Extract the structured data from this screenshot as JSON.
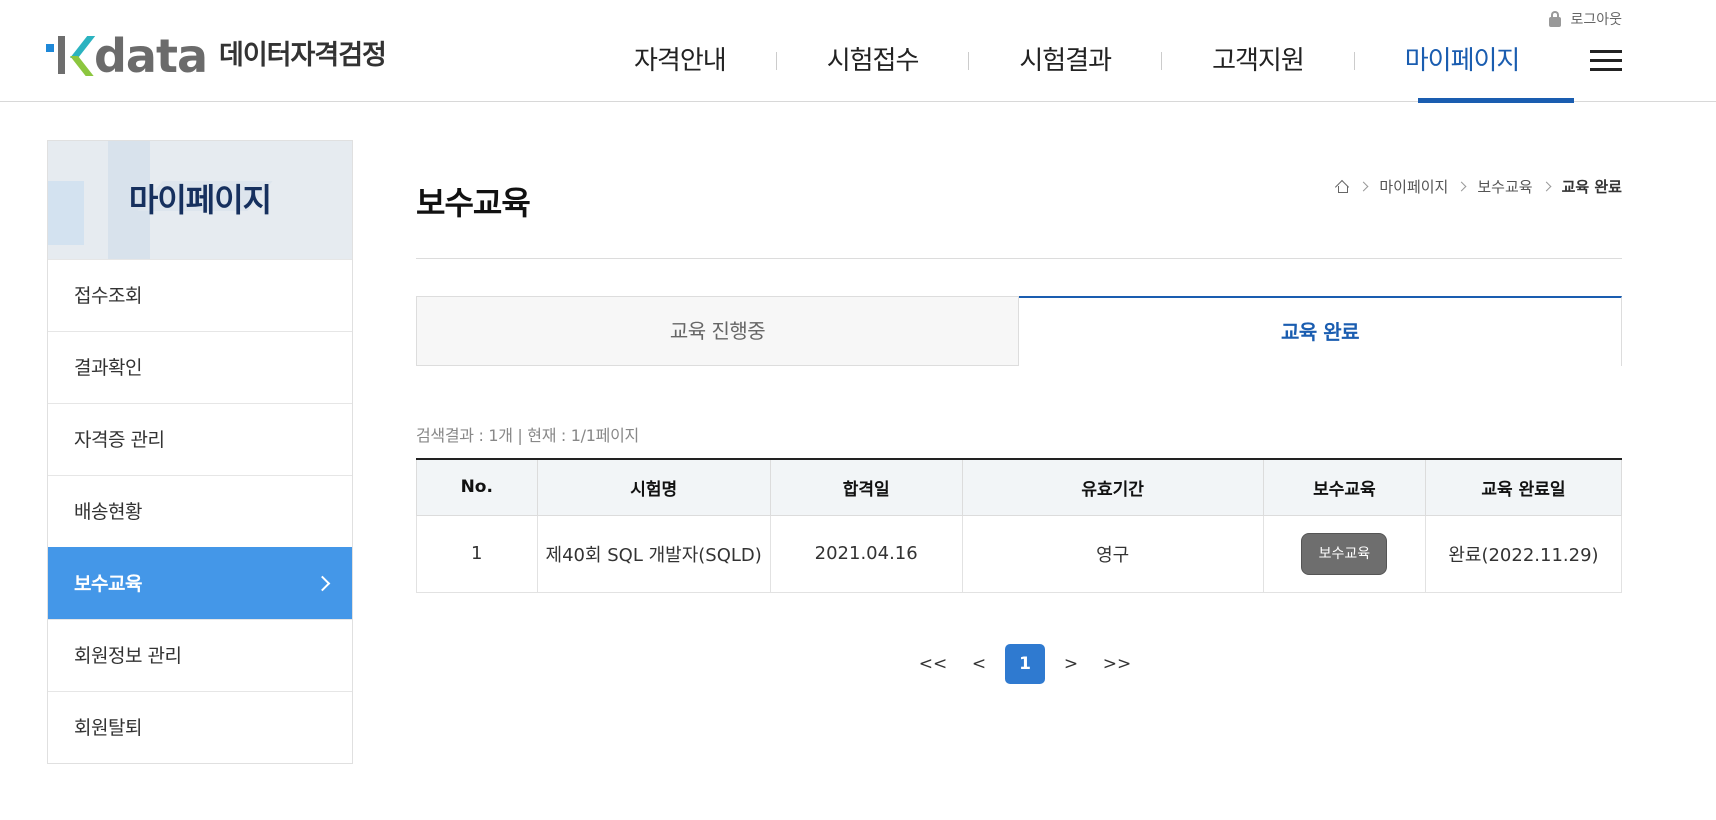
{
  "header": {
    "logo_word": "data",
    "logo_sub": "데이터자격검정",
    "logout_label": "로그아웃",
    "nav": [
      {
        "label": "자격안내"
      },
      {
        "label": "시험접수"
      },
      {
        "label": "시험결과"
      },
      {
        "label": "고객지원"
      },
      {
        "label": "마이페이지",
        "active": true
      }
    ]
  },
  "sidebar": {
    "title": "마이페이지",
    "items": [
      {
        "label": "접수조회"
      },
      {
        "label": "결과확인"
      },
      {
        "label": "자격증 관리"
      },
      {
        "label": "배송현황"
      },
      {
        "label": "보수교육",
        "active": true
      },
      {
        "label": "회원정보 관리"
      },
      {
        "label": "회원탈퇴"
      }
    ]
  },
  "main": {
    "title": "보수교육",
    "breadcrumb": [
      "마이페이지",
      "보수교육",
      "교육 완료"
    ],
    "tabs": [
      {
        "label": "교육 진행중"
      },
      {
        "label": "교육 완료",
        "active": true
      }
    ],
    "result_info": "검색결과 : 1개 | 현재 : 1/1페이지",
    "table": {
      "headers": [
        "No.",
        "시험명",
        "합격일",
        "유효기간",
        "보수교육",
        "교육 완료일"
      ],
      "rows": [
        {
          "no": "1",
          "exam": "제40회 SQL 개발자(SQLD)",
          "pass_date": "2021.04.16",
          "validity": "영구",
          "button": "보수교육",
          "completed": "완료(2022.11.29)"
        }
      ]
    },
    "pagination": {
      "first": "<<",
      "prev": "<",
      "current": "1",
      "next": ">",
      "last": ">>"
    }
  },
  "colors": {
    "accent": "#1a5db0",
    "sidebar_active": "#4497e8",
    "page_current": "#2f7ad0"
  }
}
